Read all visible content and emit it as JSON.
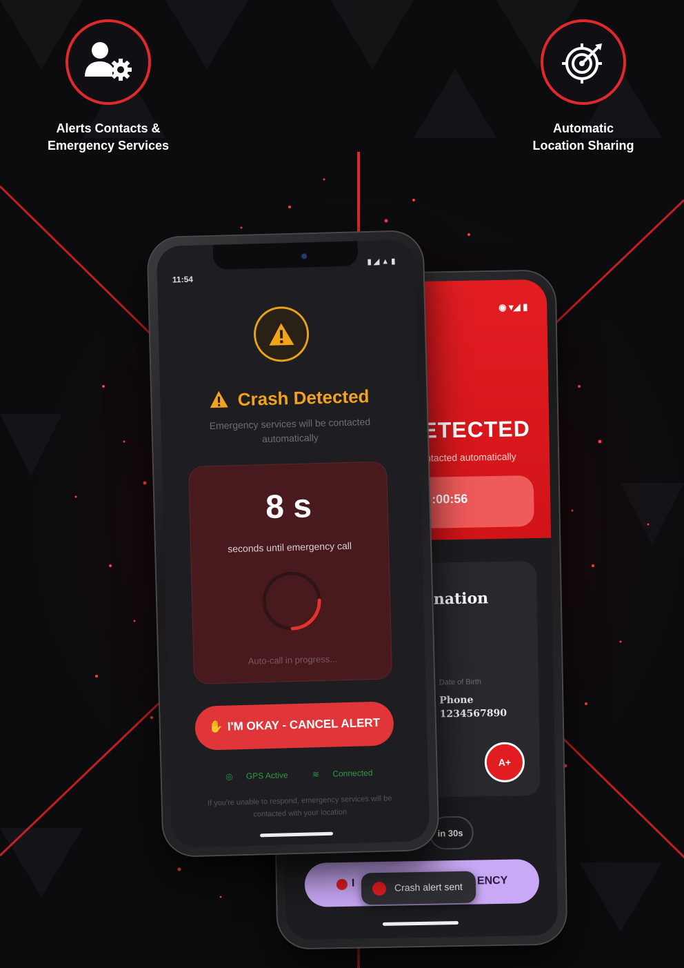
{
  "features": {
    "left": {
      "icon": "user-gear-icon",
      "line1": "Alerts Contacts &",
      "line2": "Emergency Services"
    },
    "right": {
      "icon": "target-icon",
      "line1": "Automatic",
      "line2": "Location Sharing"
    }
  },
  "colors": {
    "accent_red": "#e0292c",
    "warning_orange": "#f2a21c",
    "lavender": "#c9a8f5",
    "status_green": "#2f9d45"
  },
  "front_phone": {
    "status_time": "11:54",
    "warning_icon": "warning-icon",
    "title": "Crash Detected",
    "subtitle": "Emergency services will be contacted automatically",
    "countdown_value": "8 s",
    "countdown_caption": "seconds until emergency call",
    "progress_fraction": 0.25,
    "countdown_footer": "Auto-call in progress...",
    "cancel_button": "I'M OKAY - CANCEL ALERT",
    "gps_status": "GPS Active",
    "connection_status": "Connected",
    "footnote": "If you're unable to respond, emergency services will be contacted with your location"
  },
  "back_phone": {
    "hero_title": "ETECTED",
    "hero_subtitle": "ntacted automatically",
    "hero_timer": ":00:56",
    "info_title": "nation",
    "dob_label": "Date of Birth",
    "phone_label": "Phone",
    "phone_value": "1234567890",
    "blood_type": "A+",
    "countdown_chip": "in 30s",
    "emergency_button_left": "I",
    "emergency_button_right": "ENCY",
    "toast_text": "Crash alert sent"
  }
}
